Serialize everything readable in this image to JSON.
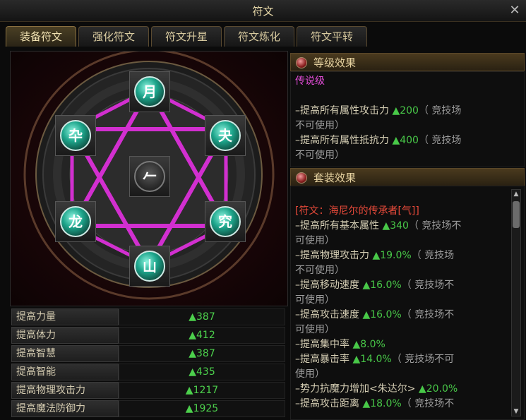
{
  "window": {
    "title": "符文",
    "close_symbol": "✕"
  },
  "tabs": [
    {
      "label": "装备符文",
      "active": true
    },
    {
      "label": "强化符文",
      "active": false
    },
    {
      "label": "符文升星",
      "active": false
    },
    {
      "label": "符文炼化",
      "active": false
    },
    {
      "label": "符文平转",
      "active": false
    }
  ],
  "runes": [
    {
      "glyph": "月"
    },
    {
      "glyph": "卆"
    },
    {
      "glyph": "夬"
    },
    {
      "glyph": "𠂉"
    },
    {
      "glyph": "龙"
    },
    {
      "glyph": "究"
    },
    {
      "glyph": "山"
    }
  ],
  "stats": [
    {
      "name": "提高力量",
      "value": "▲387"
    },
    {
      "name": "提高体力",
      "value": "▲412"
    },
    {
      "name": "提高智慧",
      "value": "▲387"
    },
    {
      "name": "提高智能",
      "value": "▲435"
    },
    {
      "name": "提高物理攻击力",
      "value": "▲1217"
    },
    {
      "name": "提高魔法防御力",
      "value": "▲1925"
    }
  ],
  "grade_effect": {
    "heading": "等级效果",
    "grade": "传说级",
    "lines": [
      {
        "text": "–提高所有属性攻击力 ",
        "value": "▲200",
        "note": "（ 竞技场"
      },
      {
        "text": "不可使用）",
        "value": "",
        "note": ""
      },
      {
        "text": "–提高所有属性抵抗力 ",
        "value": "▲400",
        "note": "（ 竞技场"
      },
      {
        "text": "不可使用）",
        "value": "",
        "note": ""
      }
    ]
  },
  "set_effect": {
    "heading": "套装效果",
    "set_name": "[符文：海尼尔的传承者[气]]",
    "lines": [
      {
        "text": " –提高所有基本属性 ",
        "value": "▲340",
        "note": "（ 竞技场不"
      },
      {
        "text": "可使用）",
        "value": "",
        "note": ""
      },
      {
        "text": " –提高物理攻击力 ",
        "value": "▲19.0%",
        "note": "（ 竞技场"
      },
      {
        "text": "不可使用）",
        "value": "",
        "note": ""
      },
      {
        "text": " –提高移动速度 ",
        "value": "▲16.0%",
        "note": "（ 竞技场不"
      },
      {
        "text": "可使用）",
        "value": "",
        "note": ""
      },
      {
        "text": " –提高攻击速度 ",
        "value": "▲16.0%",
        "note": "（ 竞技场不"
      },
      {
        "text": "可使用）",
        "value": "",
        "note": ""
      },
      {
        "text": " –提高集中率 ",
        "value": "▲8.0%",
        "note": ""
      },
      {
        "text": " –提高暴击率 ",
        "value": "▲14.0%",
        "note": "（ 竞技场不可"
      },
      {
        "text": "使用）",
        "value": "",
        "note": ""
      },
      {
        "text": " –势力抗魔力增加<朱达尔> ",
        "value": "▲20.0%",
        "note": ""
      },
      {
        "text": " –提高攻击距离 ",
        "value": "▲18.0%",
        "note": "（ 竞技场不"
      }
    ]
  },
  "colors": {
    "star_lines": "#d22fd0",
    "gem": "#1da58b",
    "positive": "#48c848",
    "grade_purple": "#e04cd6",
    "set_red": "#e84a3a"
  },
  "icons": {
    "close": "close-icon",
    "bullet": "red-orb-icon",
    "scroll_up": "scroll-up-icon",
    "scroll_down": "scroll-down-icon"
  }
}
